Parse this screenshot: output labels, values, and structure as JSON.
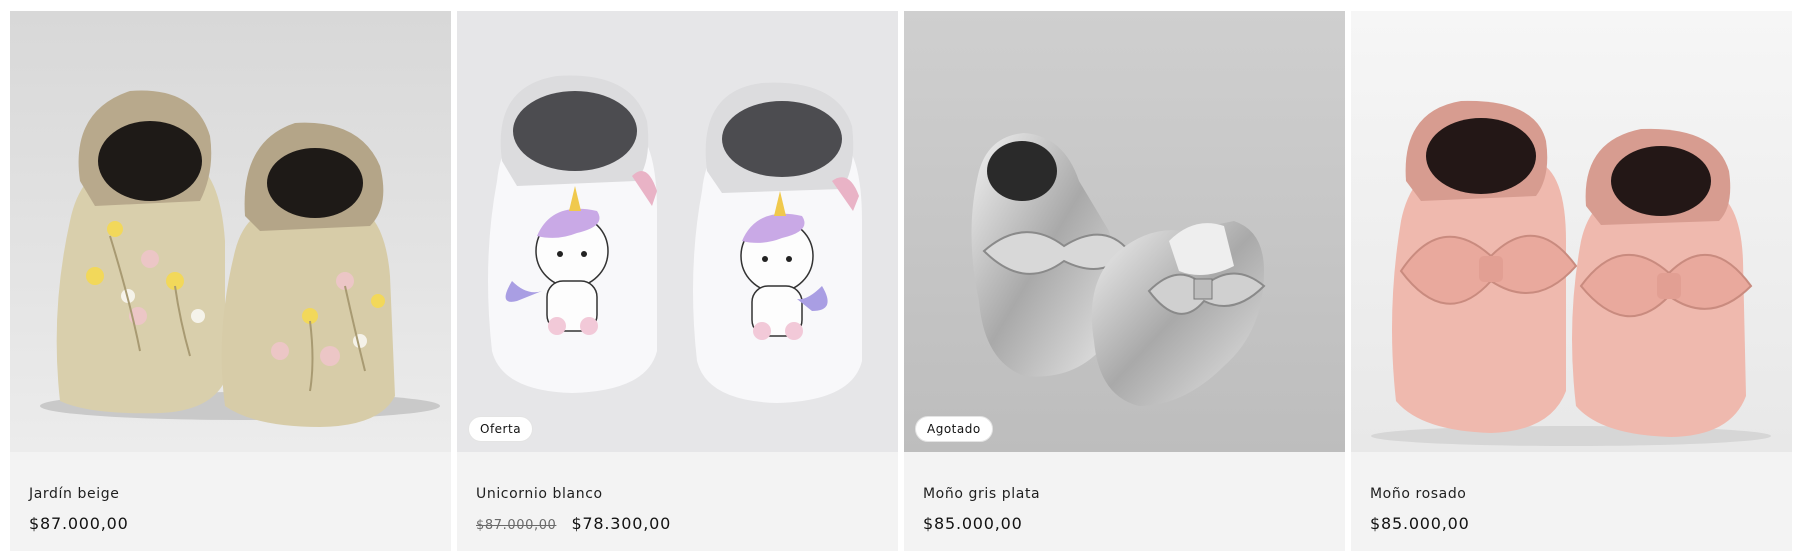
{
  "products": [
    {
      "title": "Jardín beige",
      "price": "$87.000,00",
      "badge": null
    },
    {
      "title": "Unicornio blanco",
      "price_old": "$87.000,00",
      "price": "$78.300,00",
      "badge": "Oferta"
    },
    {
      "title": "Moño gris plata",
      "price": "$85.000,00",
      "badge": "Agotado"
    },
    {
      "title": "Moño rosado",
      "price": "$85.000,00",
      "badge": null
    }
  ]
}
